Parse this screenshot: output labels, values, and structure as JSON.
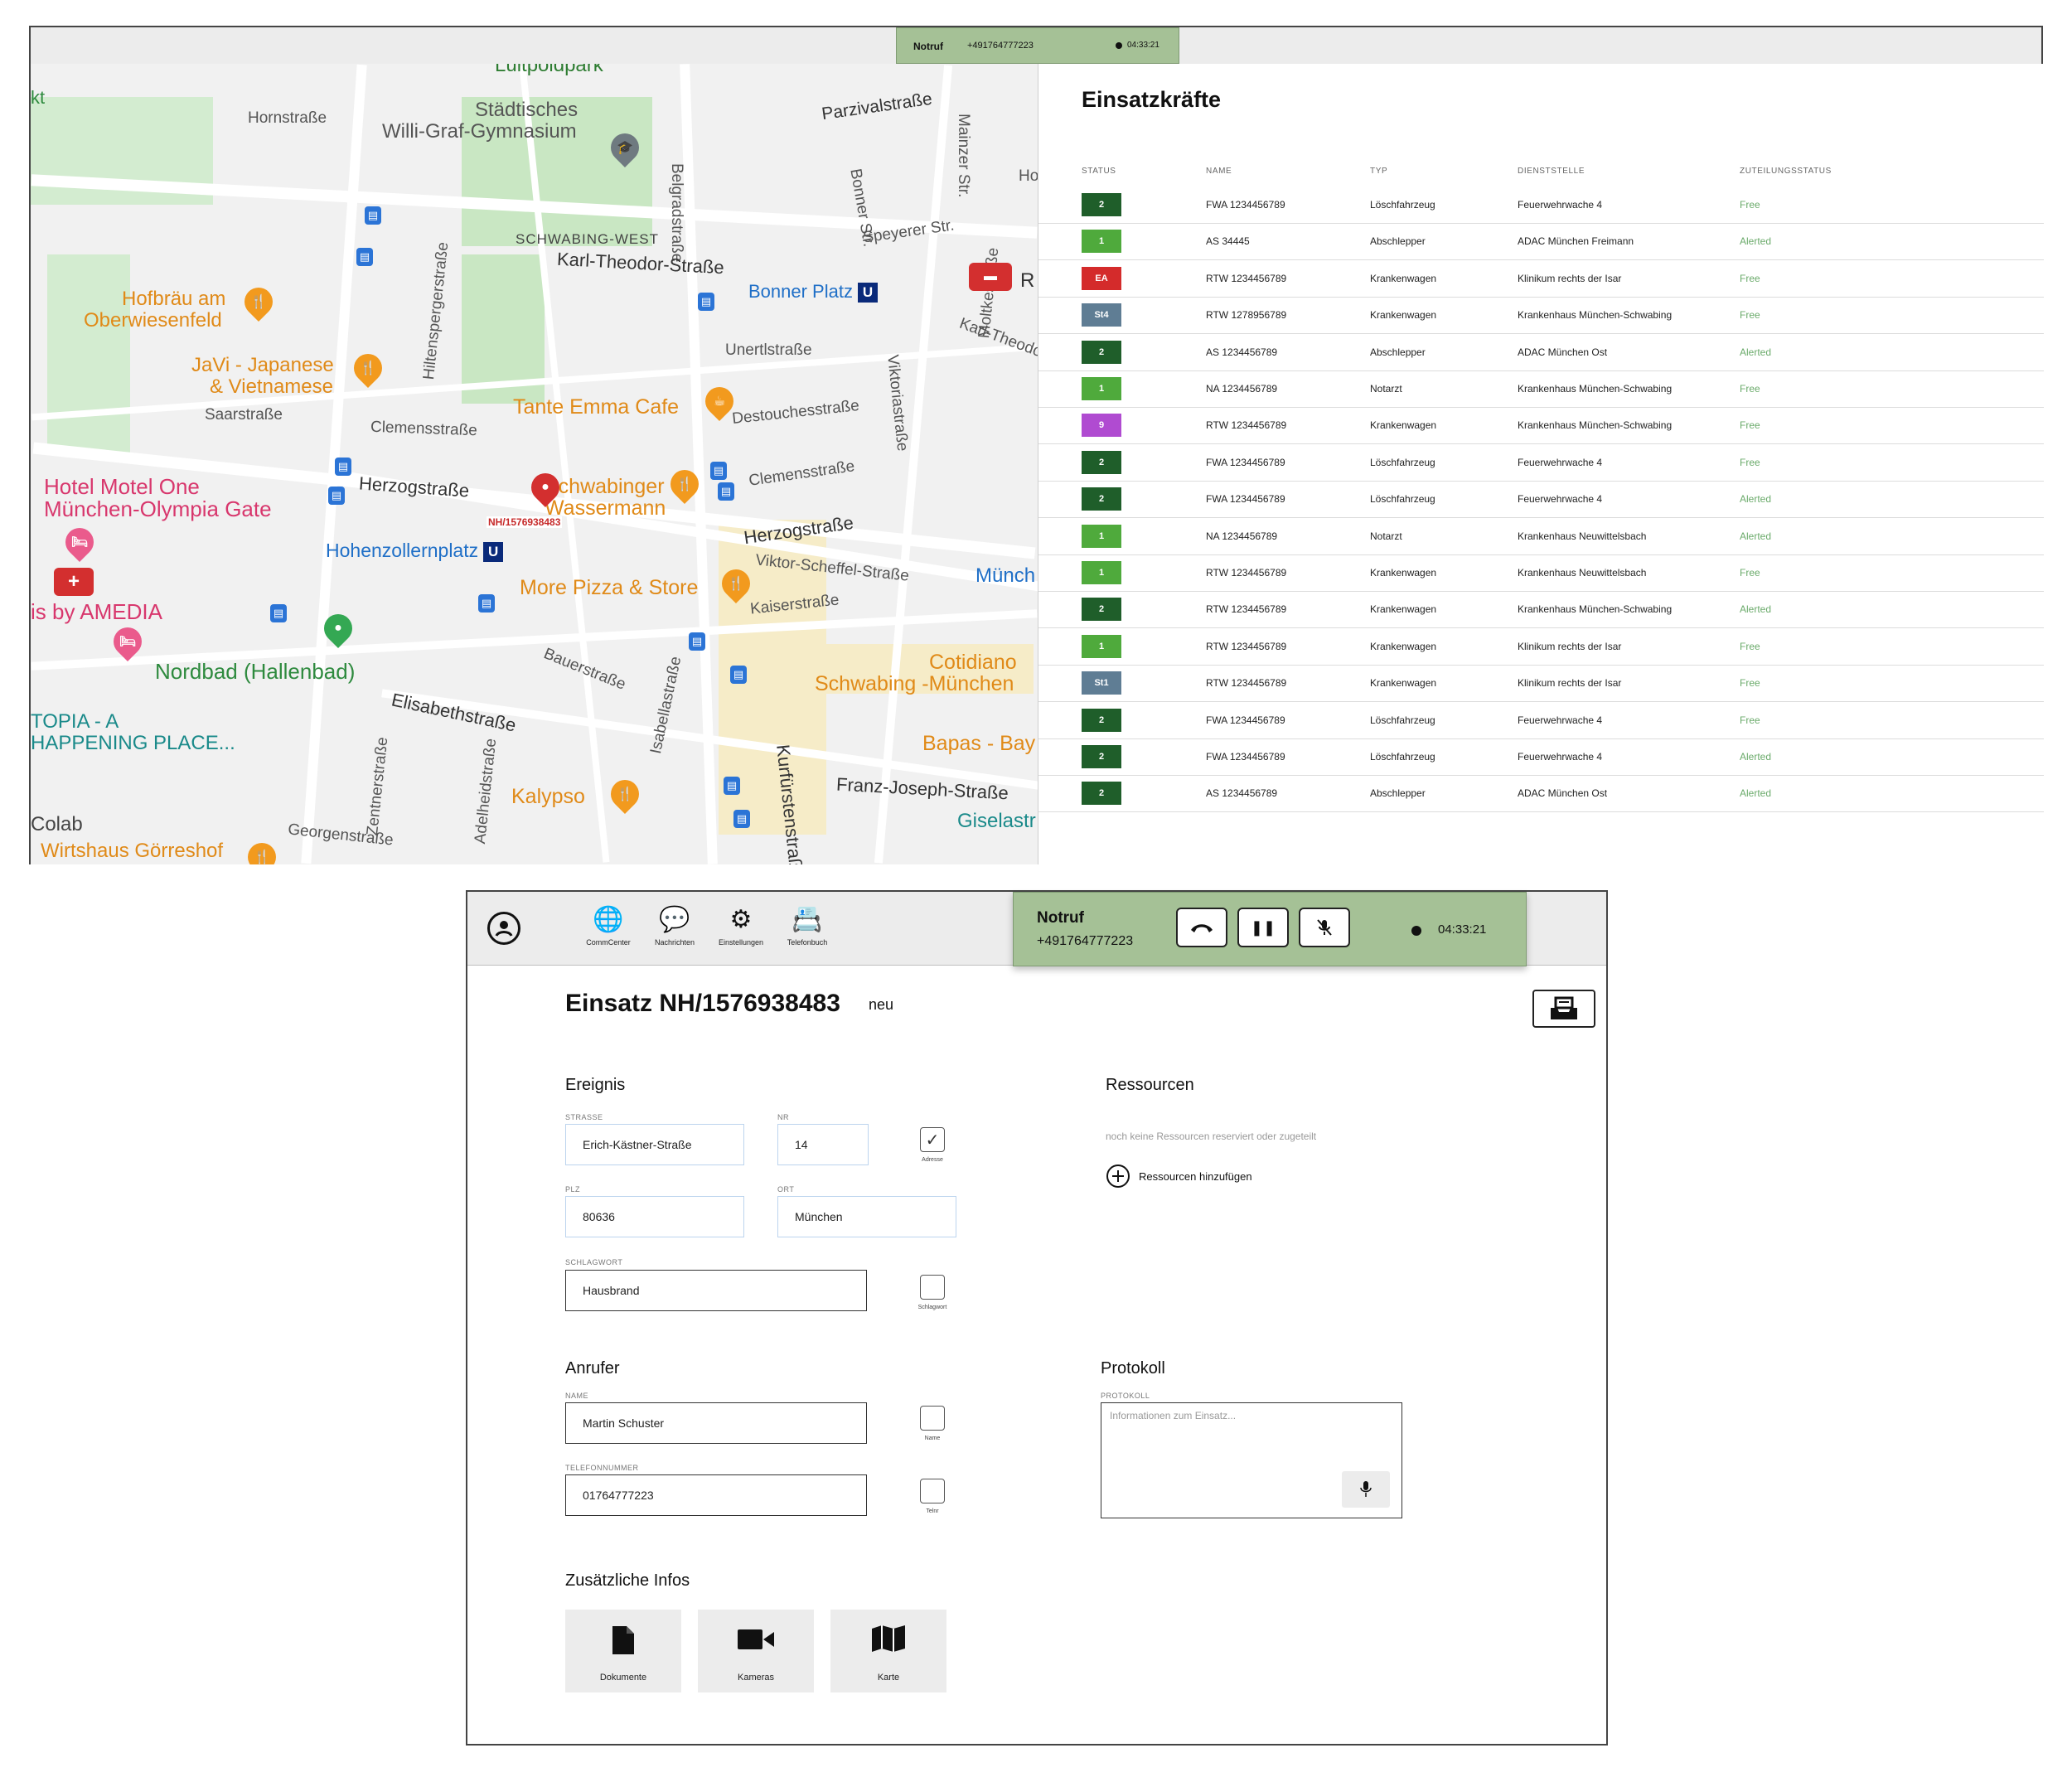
{
  "topbar": {
    "call_label": "Notruf",
    "phone": "+491764777223",
    "timer": "04:33:21"
  },
  "map": {
    "labels": {
      "luitpoldpark": "Luitpoldpark",
      "hornstrasse": "Hornstraße",
      "gymnasium_1": "Städtisches",
      "gymnasium_2": "Willi-Graf-Gymnasium",
      "belgradstrasse": "Belgradstraße",
      "parzivalstrasse": "Parzivalstraße",
      "mainzer": "Mainzer Str.",
      "bonner": "Bonner Str.",
      "speyerer": "Speyerer Str.",
      "schwabing_west": "SCHWABING-WEST",
      "karl_theodor": "Karl-Theodor-Straße",
      "bonner_platz": "Bonner Platz",
      "hofbraeu_1": "Hofbräu am",
      "hofbraeu_2": "Oberwiesenfeld",
      "javi_1": "JaVi - Japanese",
      "javi_2": "& Vietnamese",
      "saarstrasse": "Saarstraße",
      "hiltensperger": "Hiltenspergerstraße",
      "unertl": "Unertlstraße",
      "tante_emma": "Tante Emma Cafe",
      "destouches": "Destouchesstraße",
      "viktoria": "Viktoriastraße",
      "moltke": "Moltkestraße",
      "clemens_1": "Clemensstraße",
      "clemens_2": "Clemensstraße",
      "hotel_1": "Hotel Motel One",
      "hotel_2": "München-Olympia Gate",
      "herzog_1": "Herzogstraße",
      "schwabinger_1": "Schwabinger",
      "schwabinger_2": "Wassermann",
      "herzog_2": "Herzogstraße",
      "incident_pin": "NH/1576938483",
      "hohenzollern": "Hohenzollernplatz",
      "more_pizza": "More Pizza & Store",
      "viktor_scheffel": "Viktor-Scheffel-Straße",
      "muench": "Münch",
      "kaiser": "Kaiserstraße",
      "amedia": "is by AMEDIA",
      "nordbad": "Nordbad (Hallenbad)",
      "bauer": "Bauerstraße",
      "isabella": "Isabellastraße",
      "cotidiano_1": "Cotidiano",
      "cotidiano_2": "Schwabing -München",
      "utopia_1": "TOPIA - A",
      "utopia_2": "HAPPENING PLACE...",
      "elisabeth": "Elisabethstraße",
      "zentner": "Zentnerstraße",
      "adelheid": "Adelheidstraße",
      "kurfuersten": "Kurfürstenstraße",
      "bapas": "Bapas - Bay",
      "franz_joseph": "Franz-Joseph-Straße",
      "kalypso": "Kalypso",
      "colab": "Colab",
      "giselastr": "Giselastr",
      "georgen": "Georgenstraße",
      "wirtshaus": "Wirtshaus Görreshof",
      "kt": "kt",
      "r_edge": "R",
      "karl_theodo_edge": "Karl-Theodo",
      "ho_edge": "Ho"
    }
  },
  "units": {
    "title": "Einsatzkräfte",
    "headers": [
      "STATUS",
      "NAME",
      "TYP",
      "DIENSTSTELLE",
      "ZUTEILUNGSSTATUS"
    ],
    "status_colors": {
      "2": "#1f5e2a",
      "1": "#4faa3c",
      "EA": "#d42b2b",
      "St4": "#5f7d94",
      "9": "#b04bd1",
      "St1": "#5f7d94"
    },
    "rows": [
      {
        "status": "2",
        "name": "FWA 1234456789",
        "typ": "Löschfahrzeug",
        "dienststelle": "Feuerwehrwache 4",
        "zuteilung": "Free"
      },
      {
        "status": "1",
        "name": "AS 34445",
        "typ": "Abschlepper",
        "dienststelle": "ADAC München Freimann",
        "zuteilung": "Alerted"
      },
      {
        "status": "EA",
        "name": "RTW 1234456789",
        "typ": "Krankenwagen",
        "dienststelle": "Klinikum rechts der Isar",
        "zuteilung": "Free"
      },
      {
        "status": "St4",
        "name": "RTW 1278956789",
        "typ": "Krankenwagen",
        "dienststelle": "Krankenhaus München-Schwabing",
        "zuteilung": "Free"
      },
      {
        "status": "2",
        "name": "AS 1234456789",
        "typ": "Abschlepper",
        "dienststelle": "ADAC München Ost",
        "zuteilung": "Alerted"
      },
      {
        "status": "1",
        "name": "NA 1234456789",
        "typ": "Notarzt",
        "dienststelle": "Krankenhaus München-Schwabing",
        "zuteilung": "Free"
      },
      {
        "status": "9",
        "name": "RTW 1234456789",
        "typ": "Krankenwagen",
        "dienststelle": "Krankenhaus München-Schwabing",
        "zuteilung": "Free"
      },
      {
        "status": "2",
        "name": "FWA 1234456789",
        "typ": "Löschfahrzeug",
        "dienststelle": "Feuerwehrwache 4",
        "zuteilung": "Free"
      },
      {
        "status": "2",
        "name": "FWA 1234456789",
        "typ": "Löschfahrzeug",
        "dienststelle": "Feuerwehrwache 4",
        "zuteilung": "Alerted"
      },
      {
        "status": "1",
        "name": "NA 1234456789",
        "typ": "Notarzt",
        "dienststelle": "Krankenhaus Neuwittelsbach",
        "zuteilung": "Alerted"
      },
      {
        "status": "1",
        "name": "RTW 1234456789",
        "typ": "Krankenwagen",
        "dienststelle": "Krankenhaus Neuwittelsbach",
        "zuteilung": "Free"
      },
      {
        "status": "2",
        "name": "RTW 1234456789",
        "typ": "Krankenwagen",
        "dienststelle": "Krankenhaus München-Schwabing",
        "zuteilung": "Alerted"
      },
      {
        "status": "1",
        "name": "RTW 1234456789",
        "typ": "Krankenwagen",
        "dienststelle": "Klinikum rechts der Isar",
        "zuteilung": "Free"
      },
      {
        "status": "St1",
        "name": "RTW 1234456789",
        "typ": "Krankenwagen",
        "dienststelle": "Klinikum rechts der Isar",
        "zuteilung": "Free"
      },
      {
        "status": "2",
        "name": "FWA 1234456789",
        "typ": "Löschfahrzeug",
        "dienststelle": "Feuerwehrwache 4",
        "zuteilung": "Free"
      },
      {
        "status": "2",
        "name": "FWA 1234456789",
        "typ": "Löschfahrzeug",
        "dienststelle": "Feuerwehrwache 4",
        "zuteilung": "Alerted"
      },
      {
        "status": "2",
        "name": "AS 1234456789",
        "typ": "Abschlepper",
        "dienststelle": "ADAC München Ost",
        "zuteilung": "Alerted"
      }
    ]
  },
  "detail": {
    "nav": [
      {
        "label": "CommCenter",
        "icon": "globe-icon"
      },
      {
        "label": "Nachrichten",
        "icon": "chat-icon"
      },
      {
        "label": "Einstellungen",
        "icon": "gear-icon"
      },
      {
        "label": "Telefonbuch",
        "icon": "phonebook-icon"
      }
    ],
    "call": {
      "label": "Notruf",
      "phone": "+491764777223",
      "timer": "04:33:21"
    },
    "title": "Einsatz NH/1576938483",
    "state": "neu",
    "ereignis": {
      "heading": "Ereignis",
      "strasse_label": "STRASSE",
      "strasse": "Erich-Kästner-Straße",
      "nr_label": "NR",
      "nr": "14",
      "adresse_cb_label": "Adresse",
      "plz_label": "PLZ",
      "plz": "80636",
      "ort_label": "ORT",
      "ort": "München",
      "schlagwort_label": "SCHLAGWORT",
      "schlagwort": "Hausbrand",
      "schlagwort_cb_label": "Schlagwort"
    },
    "ressourcen": {
      "heading": "Ressourcen",
      "empty": "noch keine Ressourcen reserviert oder zugeteilt",
      "add": "Ressourcen hinzufügen"
    },
    "anrufer": {
      "heading": "Anrufer",
      "name_label": "NAME",
      "name": "Martin Schuster",
      "name_cb_label": "Name",
      "tel_label": "TELEFONNUMMER",
      "tel": "01764777223",
      "tel_cb_label": "Telnr"
    },
    "protokoll": {
      "heading": "Protokoll",
      "label": "PROTOKOLL",
      "placeholder": "Informationen zum Einsatz..."
    },
    "zusatz": {
      "heading": "Zusätzliche Infos",
      "tiles": [
        {
          "label": "Dokumente",
          "icon": "document-icon"
        },
        {
          "label": "Kameras",
          "icon": "camera-icon"
        },
        {
          "label": "Karte",
          "icon": "map-icon"
        }
      ]
    }
  }
}
